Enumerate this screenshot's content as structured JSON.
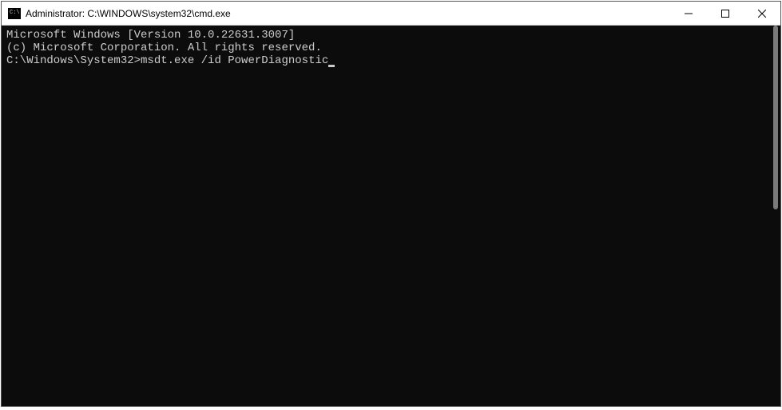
{
  "window": {
    "title": "Administrator: C:\\WINDOWS\\system32\\cmd.exe",
    "icon_label": "C:\\"
  },
  "terminal": {
    "line1": "Microsoft Windows [Version 10.0.22631.3007]",
    "line2": "(c) Microsoft Corporation. All rights reserved.",
    "blank": "",
    "prompt": "C:\\Windows\\System32>",
    "command": "msdt.exe /id PowerDiagnostic"
  }
}
